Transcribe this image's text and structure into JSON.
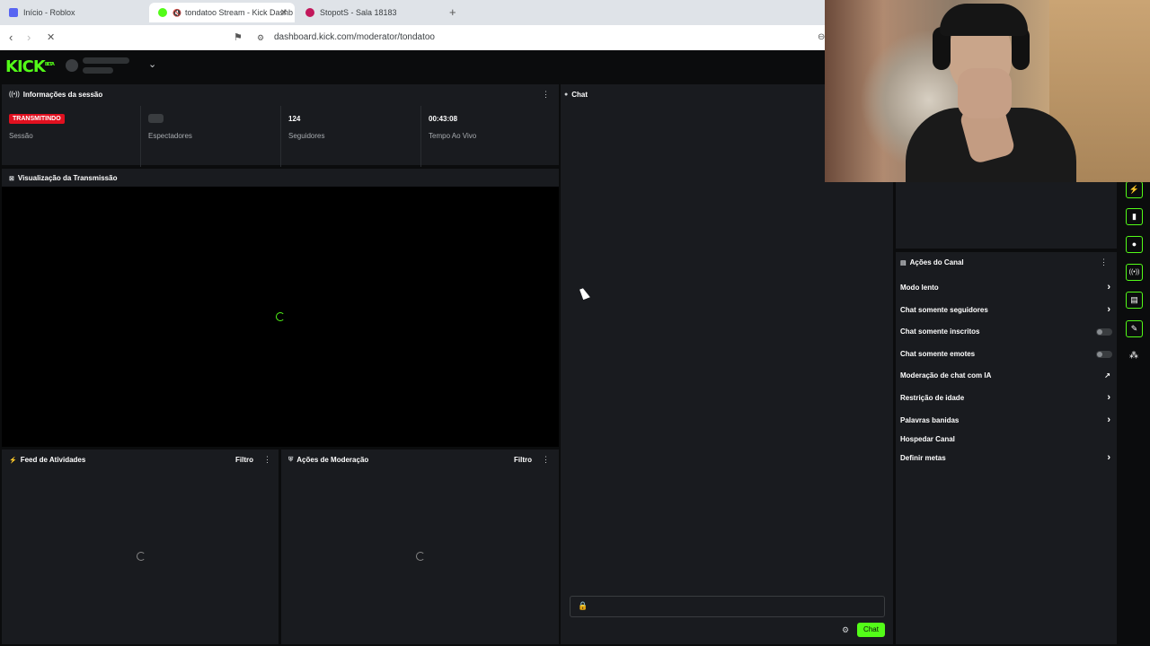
{
  "browser": {
    "tabs": [
      {
        "title": "Início - Roblox"
      },
      {
        "title": "tondatoo Stream - Kick Dashb"
      },
      {
        "title": "StopotS - Sala 18183"
      }
    ],
    "url": "dashboard.kick.com/moderator/tondatoo"
  },
  "header": {
    "logo": "KICK",
    "logo_badge": "BETA"
  },
  "session": {
    "title": "Informações da sessão",
    "status_badge": "TRANSMITINDO",
    "status_label": "Sessão",
    "viewers_label": "Espectadores",
    "followers_value": "124",
    "followers_label": "Seguidores",
    "live_time_value": "00:43:08",
    "live_time_label": "Tempo Ao Vivo"
  },
  "preview": {
    "title": "Visualização da Transmissão"
  },
  "activity": {
    "title": "Feed de Atividades",
    "filter": "Filtro"
  },
  "moderation": {
    "title": "Ações de Moderação",
    "filter": "Filtro"
  },
  "chat": {
    "title": "Chat",
    "send_label": "Chat"
  },
  "channel_actions": {
    "title": "Ações do Canal",
    "items": [
      {
        "label": "Modo lento",
        "control": "chevron"
      },
      {
        "label": "Chat somente seguidores",
        "control": "chevron"
      },
      {
        "label": "Chat somente inscritos",
        "control": "toggle"
      },
      {
        "label": "Chat somente emotes",
        "control": "toggle"
      },
      {
        "label": "Moderação de chat com IA",
        "control": "external"
      },
      {
        "label": "Restrição de idade",
        "control": "chevron"
      },
      {
        "label": "Palavras banidas",
        "control": "chevron"
      },
      {
        "label": "Hospedar Canal",
        "control": "none"
      },
      {
        "label": "Definir metas",
        "control": "chevron"
      }
    ]
  },
  "colors": {
    "accent": "#53fc18",
    "live": "#e1101f",
    "panel": "#191b1f"
  }
}
